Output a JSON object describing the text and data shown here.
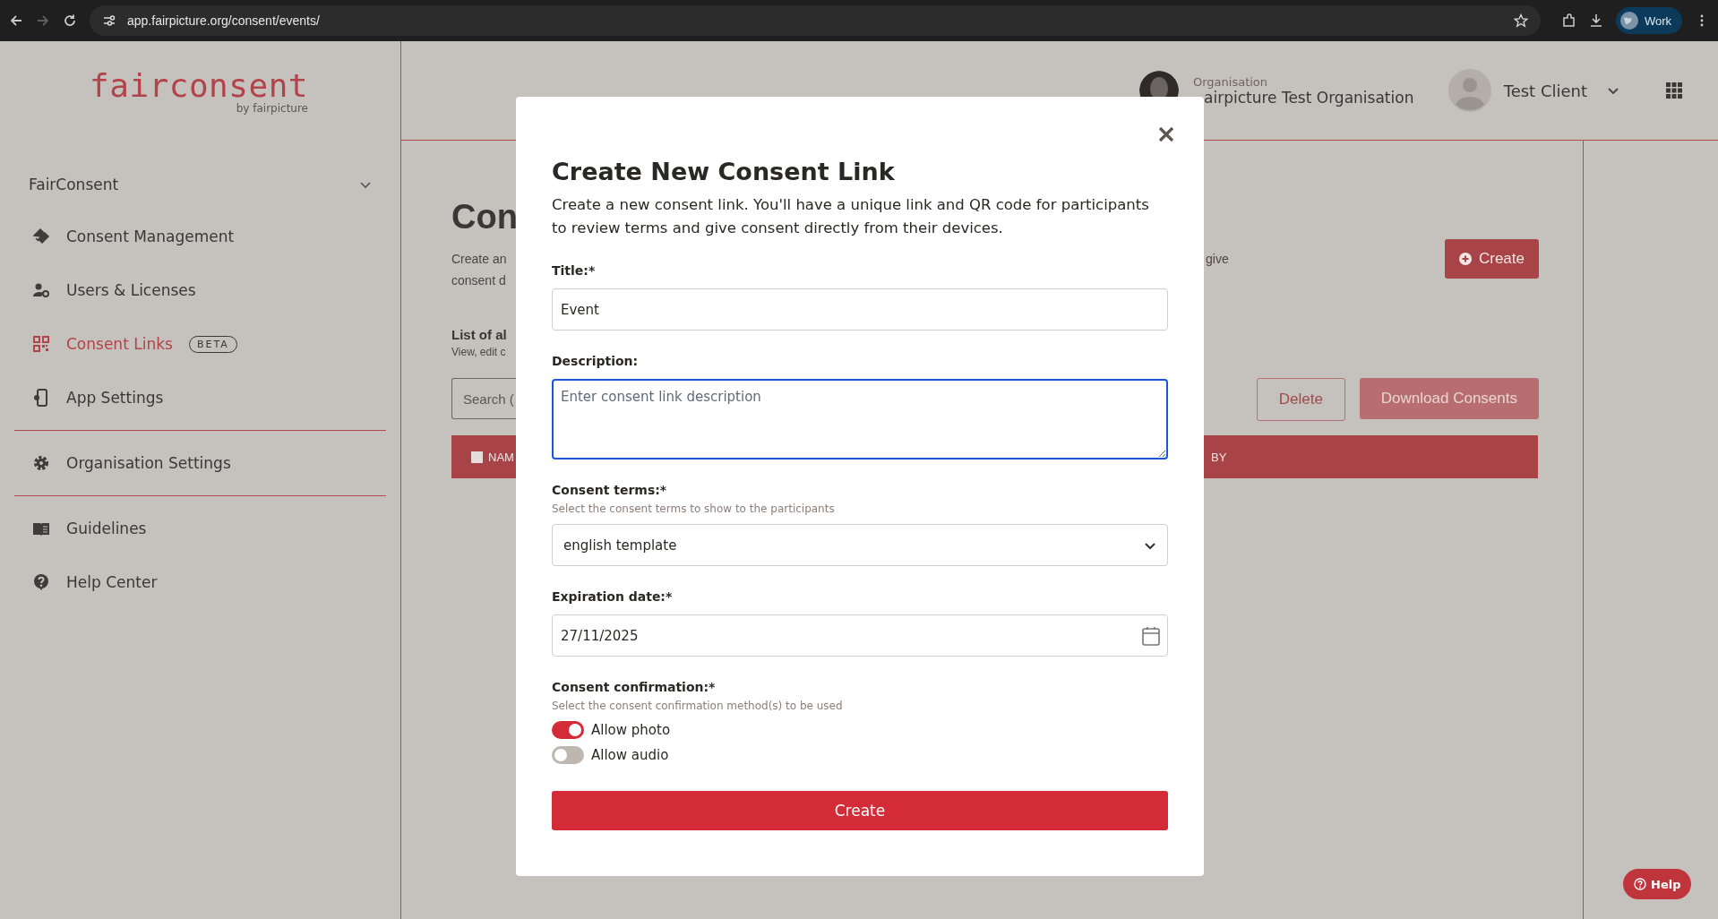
{
  "browser": {
    "url": "app.fairpicture.org/consent/events/",
    "forward_disabled": true,
    "profile": "Work"
  },
  "sidebar": {
    "logo": "fairconsent",
    "logo_sub": "by fairpicture",
    "groups": [
      {
        "label": "FairConsent",
        "expanded": true,
        "items": [
          {
            "label": "Consent Management",
            "selected": false
          },
          {
            "label": "Users & Licenses",
            "selected": false
          },
          {
            "label": "Consent Links",
            "selected": true,
            "badge": "BETA"
          },
          {
            "label": "App Settings",
            "selected": false
          }
        ]
      },
      {
        "items": [
          {
            "label": "Organisation Settings",
            "selected": false
          }
        ]
      },
      {
        "items": [
          {
            "label": "Guidelines",
            "selected": false
          },
          {
            "label": "Help Center",
            "selected": false
          }
        ]
      }
    ]
  },
  "header": {
    "org_label": "Organisation",
    "org_name": "airpicture Test Organisation",
    "user_name": "Test Client"
  },
  "page": {
    "title": "Con",
    "intro_lines": [
      "Create an",
      "consent d"
    ],
    "intro_right": "give",
    "create_button": "Create",
    "list_title": "List of al",
    "list_sub": "View, edit c",
    "search_placeholder": "Search (",
    "delete_button": {
      "label": "Delete",
      "disabled": true
    },
    "download_button": {
      "label": "Download Consents",
      "disabled": true
    },
    "table_header": {
      "checked": false,
      "left": "NAM",
      "right": "BY"
    }
  },
  "modal": {
    "title": "Create New Consent Link",
    "description": "Create a new consent link. You'll have a unique link and QR code for participants to review terms and give consent directly from their devices.",
    "fields": [
      {
        "kind": "text",
        "label": "Title:*",
        "value": "Event"
      },
      {
        "kind": "textarea",
        "label": "Description:",
        "placeholder": "Enter consent link description",
        "focused": true
      },
      {
        "kind": "select",
        "label": "Consent terms:*",
        "hint": "Select the consent terms to show to the participants",
        "value": "english template"
      },
      {
        "kind": "date",
        "label": "Expiration date:*",
        "value": "27/11/2025"
      },
      {
        "kind": "toggles",
        "label": "Consent confirmation:*",
        "hint": "Select the consent confirmation method(s) to be used",
        "options": [
          {
            "label": "Allow photo",
            "on": true
          },
          {
            "label": "Allow audio",
            "on": false
          }
        ]
      }
    ],
    "submit": "Create"
  },
  "help_button": "Help"
}
